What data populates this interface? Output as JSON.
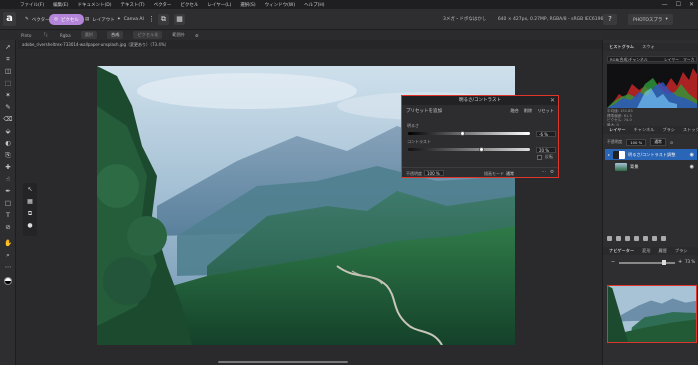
{
  "menu": [
    "ファイル(F)",
    "編集(E)",
    "ドキュメント(D)",
    "テキスト(T)",
    "ペクター",
    "ピクセル",
    "レイヤー(L)",
    "選択(S)",
    "ウィンドウ(W)",
    "ヘルプ(H)"
  ],
  "window_controls": {
    "minimize": "—",
    "maximize": "☐",
    "close": "✕"
  },
  "toolbar": {
    "logo": "a",
    "personas": [
      {
        "label": "ベクター",
        "active": false
      },
      {
        "label": "ピクセル",
        "active": true
      },
      {
        "label": "レイアウト",
        "active": false
      },
      {
        "label": "Canva AI",
        "active": false
      }
    ],
    "doc_status": "3メガ・ドボなはかし",
    "doc_info": "640 × 427px, 0.27MP, RGBA/8 - sRGB IEC61966-2.1",
    "help_icon": "?",
    "studio_label": "PHOTOスプラ"
  },
  "context_bar": {
    "items": [
      "Pinto",
      "「」",
      "Rgba",
      "選択",
      "合成",
      "ピクセル化",
      "範囲外"
    ]
  },
  "doc_tab": "adobe_riversheltrex-733014-wallpaper-unsplash.jpg（変更あり）（73.4%）",
  "adjustment": {
    "title": "明るさ/コントラスト",
    "preset_label": "プリセットを追加",
    "buttons": [
      "融合",
      "削除",
      "リセット"
    ],
    "brightness_label": "明るさ",
    "brightness_value": "-6 %",
    "brightness_level": 0.45,
    "contrast_label": "コントラスト",
    "contrast_value": "20 %",
    "contrast_level": 0.6,
    "invert_label": "反転",
    "opacity_label": "不透明度",
    "opacity_value": "100 %",
    "blend_label": "描画モード",
    "blend_value": "通常"
  },
  "right_panel": {
    "top_tabs": [
      "ヒストグラム",
      "スウォ"
    ],
    "histogram_header": [
      "RGB(合成)チャンネル",
      "レイヤー",
      "マーカー"
    ],
    "histogram_info": [
      "平均値: 151.83",
      "標準偏差: 61.5",
      "ピクセル: 74.0",
      "最大: 0"
    ],
    "layer_tabs": [
      "レイヤー",
      "チャンネル",
      "ブラシ",
      "ストック"
    ],
    "layer_options": {
      "opacity_label": "不透明度",
      "opacity_value": "100 %",
      "blend_value": "通常"
    },
    "layers": [
      {
        "name": "明るさ/コントラスト調整",
        "selected": true
      },
      {
        "name": "背景",
        "selected": false
      }
    ],
    "nav_tabs": [
      "ナビゲーター",
      "変形",
      "履歴",
      "ブラシ"
    ],
    "nav_zoom": "73 %"
  },
  "colors": {
    "accent": "#b485d8",
    "selection": "#2a66b8",
    "dialog_border": "#e0352b"
  }
}
